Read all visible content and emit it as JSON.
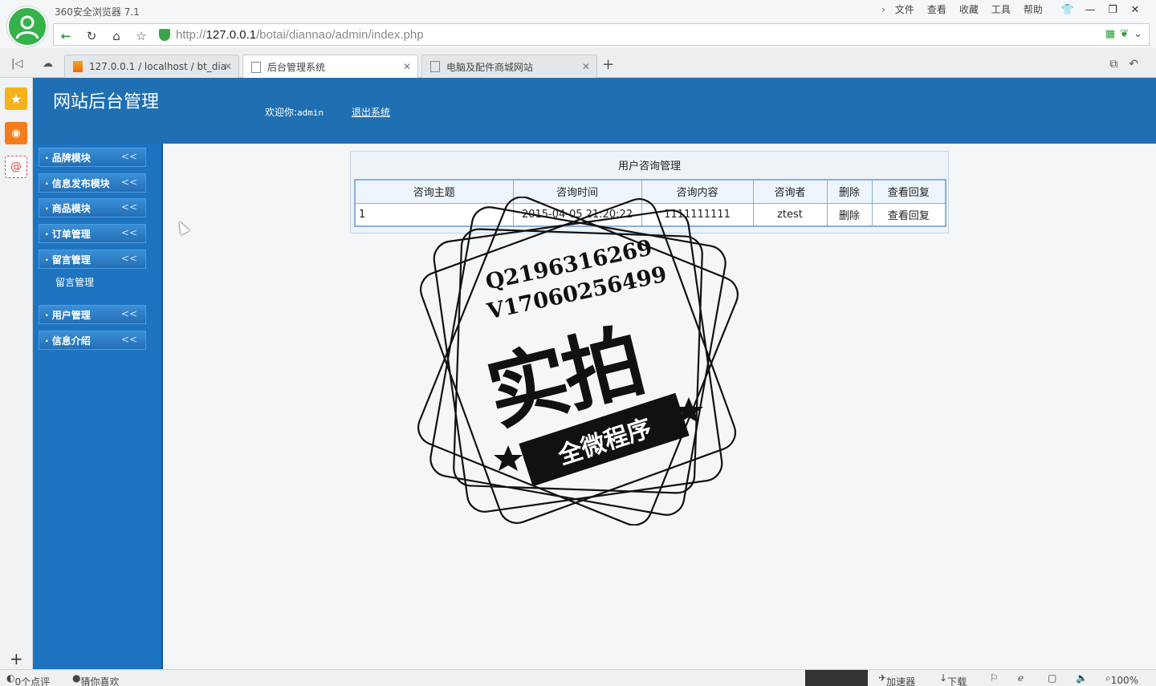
{
  "browser": {
    "app_title": "360安全浏览器 7.1",
    "menu": [
      "文件",
      "查看",
      "收藏",
      "工具",
      "帮助"
    ],
    "url_prefix": "http://",
    "url_host": "127.0.0.1",
    "url_path": "/botai/diannao/admin/index.php",
    "tabs": [
      {
        "label": "127.0.0.1 / localhost / bt_dia",
        "icon": "phpmyadmin-icon"
      },
      {
        "label": "后台管理系统",
        "icon": "page-icon"
      },
      {
        "label": "电脑及配件商城网站",
        "icon": "page-icon"
      }
    ],
    "active_tab": 1,
    "status": {
      "comments": "0个点评",
      "guess": "猜你喜欢",
      "accelerator": "加速器",
      "download": "下载",
      "zoom": "100%"
    }
  },
  "header": {
    "site_title": "网站后台管理",
    "welcome_label": "欢迎你:",
    "welcome_user": "admin",
    "logout": "退出系统"
  },
  "sidebar": {
    "groups": [
      {
        "label": "· 品牌模块"
      },
      {
        "label": "· 信息发布模块"
      },
      {
        "label": "· 商品模块"
      },
      {
        "label": "· 订单管理"
      },
      {
        "label": "· 留言管理",
        "sub": [
          "留言管理"
        ]
      },
      {
        "label": "· 用户管理"
      },
      {
        "label": "· 信息介绍"
      }
    ],
    "chevron": "<<"
  },
  "main": {
    "panel_title": "用户咨询管理",
    "columns": [
      "咨询主题",
      "咨询时间",
      "咨询内容",
      "咨询者",
      "删除",
      "查看回复"
    ],
    "rows": [
      [
        "1",
        "2015-04-05 21:20:22",
        "1111111111",
        "ztest",
        "删除",
        "查看回复"
      ]
    ]
  },
  "watermark": {
    "line1": "Q2196316269",
    "line2": "V17060256499",
    "big": "实拍",
    "ribbon": "全微程序"
  }
}
